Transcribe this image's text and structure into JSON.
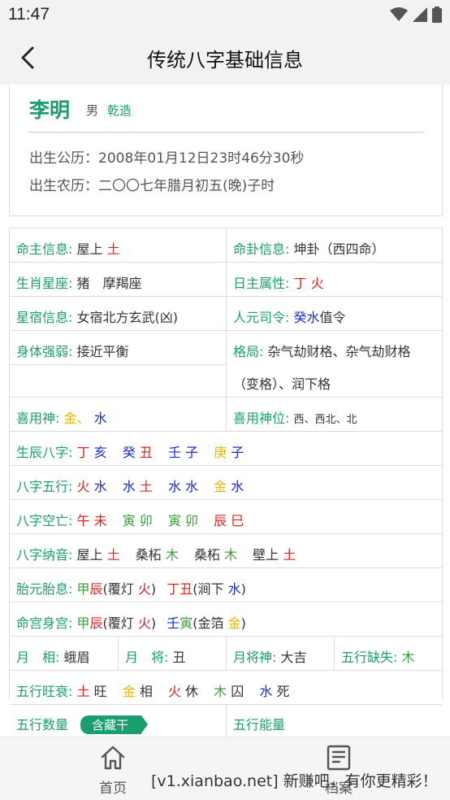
{
  "status": {
    "time": "11:47"
  },
  "appbar": {
    "title": "传统八字基础信息"
  },
  "profile": {
    "name": "李明",
    "gender": "男",
    "qianzao": "乾造",
    "solar_label": "出生公历：",
    "solar_value": "2008年01月12日23时46分30秒",
    "lunar_label": "出生农历：",
    "lunar_value": "二〇〇七年腊月初五(晚)子时"
  },
  "info": {
    "mingzhu_label": "命主信息:",
    "mingzhu_a": "屋上",
    "mingzhu_b": "土",
    "minggua_label": "命卦信息:",
    "minggua_value": "坤卦（西四命）",
    "shengxiao_label": "生肖星座:",
    "shengxiao_value": "猪　摩羯座",
    "rizhu_label": "日主属性:",
    "rizhu_value": "丁 火",
    "xingxiu_label": "星宿信息:",
    "xingxiu_value": "女宿北方玄武(凶)",
    "renyuan_label": "人元司令:",
    "renyuan_a": "癸水",
    "renyuan_b": "值令",
    "shenti_label": "身体强弱:",
    "shenti_value": "接近平衡",
    "geju_label": "格局:",
    "geju_line1": "杂气劫财格、杂气劫财格",
    "geju_line2": "（变格）、润下格",
    "xiyong_label": "喜用神:",
    "xiyong_a": "金",
    "xiyong_sep": "、",
    "xiyong_b": "水",
    "xiyongwei_label": "喜用神位:",
    "xiyongwei_value": "西、西北、北"
  },
  "bazi": {
    "shengchen_label": "生辰八字:",
    "shengchen": [
      {
        "a": "丁",
        "b": "亥"
      },
      {
        "a": "癸",
        "b": "丑"
      },
      {
        "a": "壬",
        "b": "子"
      },
      {
        "a": "庚",
        "b": "子"
      }
    ],
    "wuxing_label": "八字五行:",
    "wuxing": [
      {
        "a": "火",
        "b": "水"
      },
      {
        "a": "水",
        "b": "土"
      },
      {
        "a": "水",
        "b": "水"
      },
      {
        "a": "金",
        "b": "水"
      }
    ],
    "kongwang_label": "八字空亡:",
    "kongwang": [
      {
        "a": "午",
        "b": "未"
      },
      {
        "a": "寅",
        "b": "卯"
      },
      {
        "a": "寅",
        "b": "卯"
      },
      {
        "a": "辰",
        "b": "巳"
      }
    ],
    "nayin_label": "八字纳音:",
    "nayin": [
      {
        "a": "屋上",
        "b": "土"
      },
      {
        "a": "桑柘",
        "b": "木"
      },
      {
        "a": "桑柘",
        "b": "木"
      },
      {
        "a": "壁上",
        "b": "土"
      }
    ],
    "taiyuan_label": "胎元胎息:",
    "taiyuan_1": "甲",
    "taiyuan_2": "辰",
    "taiyuan_3": "(覆灯 ",
    "taiyuan_4": "火",
    "taiyuan_5": ")",
    "taiyuan_6": "丁",
    "taiyuan_7": "丑",
    "taiyuan_8": "(涧下 ",
    "taiyuan_9": "水",
    "taiyuan_10": ")",
    "minggong_label": "命宫身宫:",
    "minggong_1": "甲",
    "minggong_2": "辰",
    "minggong_3": "(覆灯 ",
    "minggong_4": "火",
    "minggong_5": ")",
    "minggong_6": "壬",
    "minggong_7": "寅",
    "minggong_8": "(金箔 ",
    "minggong_9": "金",
    "minggong_10": ")",
    "yuexiang_label": "月　相:",
    "yuexiang_value": "蛾眉",
    "yuejiang_label": "月　将:",
    "yuejiang_value": "丑",
    "yuejiangshen_label": "月将神:",
    "yuejiangshen_value": "大吉",
    "queshi_label": "五行缺失:",
    "queshi_value": "木",
    "wangshuai_label": "五行旺衰:",
    "wangshuai": [
      {
        "a": "土",
        "b": "旺"
      },
      {
        "a": "金",
        "b": "相"
      },
      {
        "a": "火",
        "b": "休"
      },
      {
        "a": "木",
        "b": "囚"
      },
      {
        "a": "水",
        "b": "死"
      }
    ],
    "shuliang_label": "五行数量",
    "cangganbadge": "含藏干",
    "nengliang_label": "五行能量"
  },
  "bottom": {
    "home_label": "首页",
    "archive_label": "档案",
    "watermark": "[v1.xianbao.net] 新赚吧，有你更精彩！"
  },
  "colors": {
    "accent": "#1a9e6e",
    "fire": "#e02020",
    "water": "#1a2bd4",
    "wood": "#3a9e3a",
    "metal": "#e6b800"
  }
}
